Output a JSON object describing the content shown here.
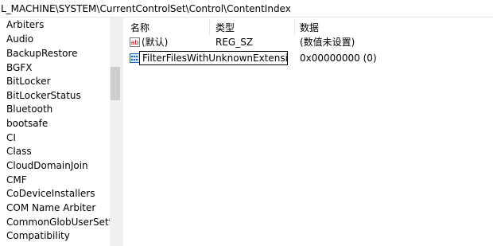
{
  "address_bar": {
    "path": "L_MACHINE\\SYSTEM\\CurrentControlSet\\Control\\ContentIndex"
  },
  "tree": {
    "items": [
      "Arbiters",
      "Audio",
      "BackupRestore",
      "BGFX",
      "BitLocker",
      "BitLockerStatus",
      "Bluetooth",
      "bootsafe",
      "CI",
      "Class",
      "CloudDomainJoin",
      "CMF",
      "CoDeviceInstallers",
      "COM Name Arbiter",
      "CommonGlobUserSettings",
      "Compatibility"
    ]
  },
  "list": {
    "headers": {
      "name": "名称",
      "type": "类型",
      "data": "数据"
    },
    "rows": [
      {
        "icon": "string-value-icon",
        "name": "(默认)",
        "type": "REG_SZ",
        "data": "(数值未设置)"
      },
      {
        "icon": "dword-value-icon",
        "name": "FilterFilesWithUnknownExtensions",
        "type": "",
        "data": "0x00000000 (0)"
      }
    ],
    "editing_row": 1
  },
  "colors": {
    "rename_border": "#000000",
    "scrollbar_track": "#f0f0f0",
    "scrollbar_thumb": "#cdcdcd",
    "string_icon_text": "#c00000",
    "dword_icon_blue": "#1f5fbf"
  }
}
